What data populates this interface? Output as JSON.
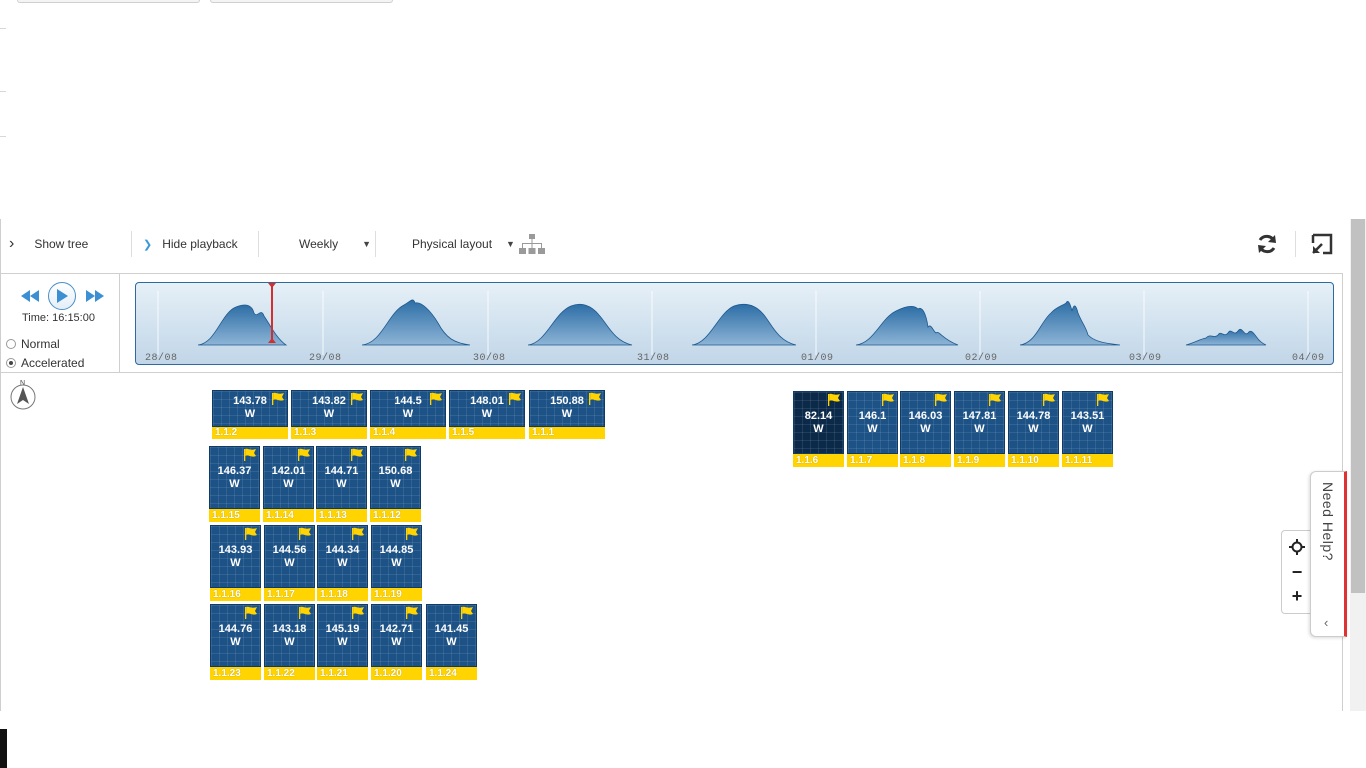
{
  "toolbar": {
    "show_tree": "Show tree",
    "hide_playback": "Hide playback",
    "period": "Weekly",
    "layout": "Physical layout"
  },
  "playback": {
    "time_label": "Time: 16:15:00",
    "modes": [
      "Normal",
      "Accelerated"
    ],
    "selected_mode": "Accelerated",
    "timeline_dates": [
      "28/08",
      "29/08",
      "30/08",
      "31/08",
      "01/09",
      "02/09",
      "03/09",
      "04/09"
    ],
    "playhead_color": "#d32f2f"
  },
  "compass_label": "N",
  "panels_left_row1": [
    {
      "value": "143.78",
      "unit": "W",
      "id": "1.1.2"
    },
    {
      "value": "143.82",
      "unit": "W",
      "id": "1.1.3"
    },
    {
      "value": "144.5",
      "unit": "W",
      "id": "1.1.4"
    },
    {
      "value": "148.01",
      "unit": "W",
      "id": "1.1.5"
    },
    {
      "value": "150.88",
      "unit": "W",
      "id": "1.1.1"
    }
  ],
  "panels_left_row2": [
    {
      "value": "146.37",
      "unit": "W",
      "id": "1.1.15"
    },
    {
      "value": "142.01",
      "unit": "W",
      "id": "1.1.14"
    },
    {
      "value": "144.71",
      "unit": "W",
      "id": "1.1.13"
    },
    {
      "value": "150.68",
      "unit": "W",
      "id": "1.1.12"
    }
  ],
  "panels_left_row3": [
    {
      "value": "143.93",
      "unit": "W",
      "id": "1.1.16"
    },
    {
      "value": "144.56",
      "unit": "W",
      "id": "1.1.17"
    },
    {
      "value": "144.34",
      "unit": "W",
      "id": "1.1.18"
    },
    {
      "value": "144.85",
      "unit": "W",
      "id": "1.1.19"
    }
  ],
  "panels_left_row4": [
    {
      "value": "144.76",
      "unit": "W",
      "id": "1.1.23"
    },
    {
      "value": "143.18",
      "unit": "W",
      "id": "1.1.22"
    },
    {
      "value": "145.19",
      "unit": "W",
      "id": "1.1.21"
    },
    {
      "value": "142.71",
      "unit": "W",
      "id": "1.1.20"
    },
    {
      "value": "141.45",
      "unit": "W",
      "id": "1.1.24"
    }
  ],
  "panels_right": [
    {
      "value": "82.14",
      "unit": "W",
      "id": "1.1.6",
      "highlight": true
    },
    {
      "value": "146.1",
      "unit": "W",
      "id": "1.1.7"
    },
    {
      "value": "146.03",
      "unit": "W",
      "id": "1.1.8"
    },
    {
      "value": "147.81",
      "unit": "W",
      "id": "1.1.9"
    },
    {
      "value": "144.78",
      "unit": "W",
      "id": "1.1.10"
    },
    {
      "value": "143.51",
      "unit": "W",
      "id": "1.1.11"
    }
  ],
  "help": {
    "label": "Need Help?"
  },
  "colors": {
    "panel_blue": "#1d5286",
    "panel_label_yellow": "#ffd400",
    "accent_blue": "#3b9ad9",
    "help_border_red": "#d33"
  }
}
